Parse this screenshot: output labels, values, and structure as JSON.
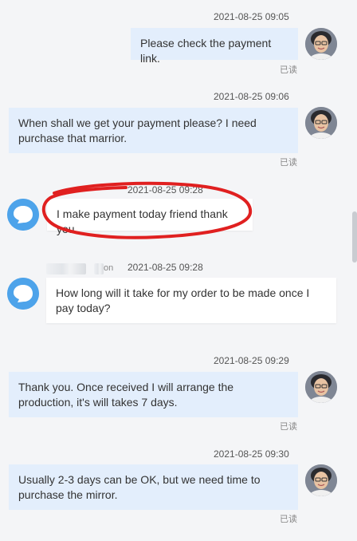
{
  "messages": [
    {
      "time": "2021-08-25 09:05",
      "text": "Please check the payment link.",
      "status": "已读"
    },
    {
      "time": "2021-08-25 09:06",
      "text": "When shall we get your payment please? I need purchase that marrior.",
      "status": "已读"
    },
    {
      "time": "2021-08-25 09:28",
      "text": "I make payment today friend thank you"
    },
    {
      "time": "2021-08-25 09:28",
      "sender_tail": "on",
      "text": "How long will it take for my order to be made once I pay today?"
    },
    {
      "time": "2021-08-25 09:29",
      "text": "Thank you. Once received I will arrange the production, it's will takes 7 days.",
      "status": "已读"
    },
    {
      "time": "2021-08-25 09:30",
      "text": "Usually 2-3 days can be OK, but we need time to purchase the mirror.",
      "status": "已读"
    }
  ],
  "colors": {
    "outgoing_bubble": "#e3eefc",
    "incoming_bubble": "#ffffff",
    "annotation_circle": "#e02020",
    "bot_avatar": "#4da3ea"
  },
  "icons": {
    "seller_avatar": "user-photo-avatar",
    "buyer_avatar": "chat-bot-avatar"
  }
}
